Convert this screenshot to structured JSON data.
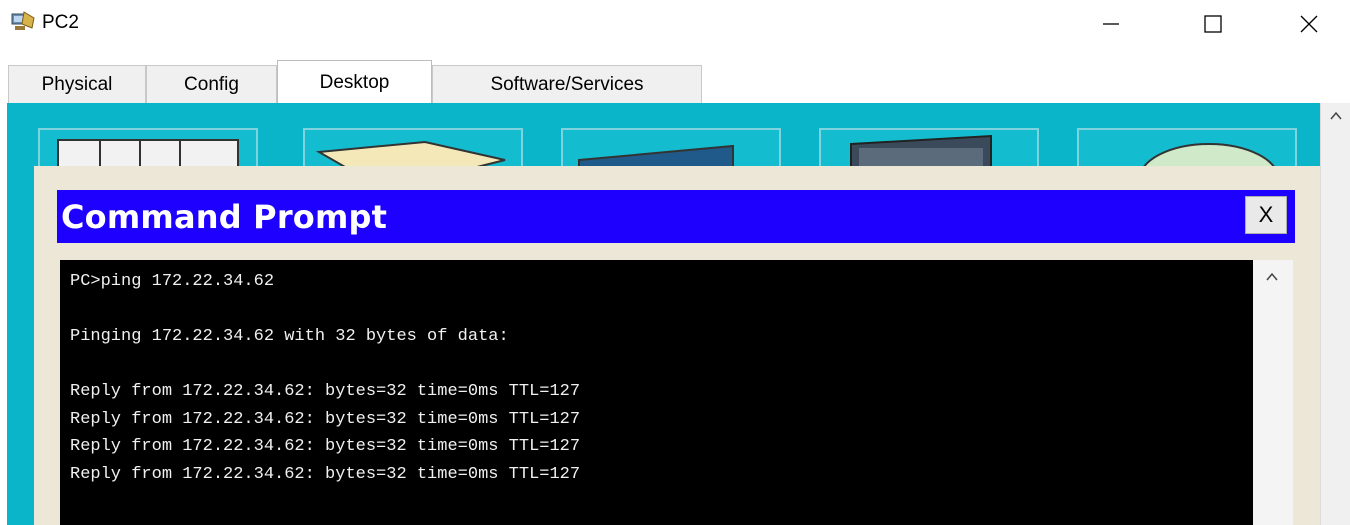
{
  "window": {
    "title": "PC2",
    "icon": "pc-device-icon",
    "controls": [
      "minimize-icon",
      "maximize-icon",
      "close-icon"
    ]
  },
  "tabs": [
    {
      "label": "Physical",
      "active": false
    },
    {
      "label": "Config",
      "active": false
    },
    {
      "label": "Desktop",
      "active": true
    },
    {
      "label": "Software/Services",
      "active": false
    }
  ],
  "cmd": {
    "title": "Command Prompt",
    "close_label": "X",
    "lines": [
      "PC>ping 172.22.34.62",
      "",
      "Pinging 172.22.34.62 with 32 bytes of data:",
      "",
      "Reply from 172.22.34.62: bytes=32 time=0ms TTL=127",
      "Reply from 172.22.34.62: bytes=32 time=0ms TTL=127",
      "Reply from 172.22.34.62: bytes=32 time=0ms TTL=127",
      "Reply from 172.22.34.62: bytes=32 time=0ms TTL=127"
    ]
  },
  "colors": {
    "desktop_bg": "#0ab4c9",
    "cmd_header": "#1e00ff",
    "console_bg": "#000000"
  }
}
